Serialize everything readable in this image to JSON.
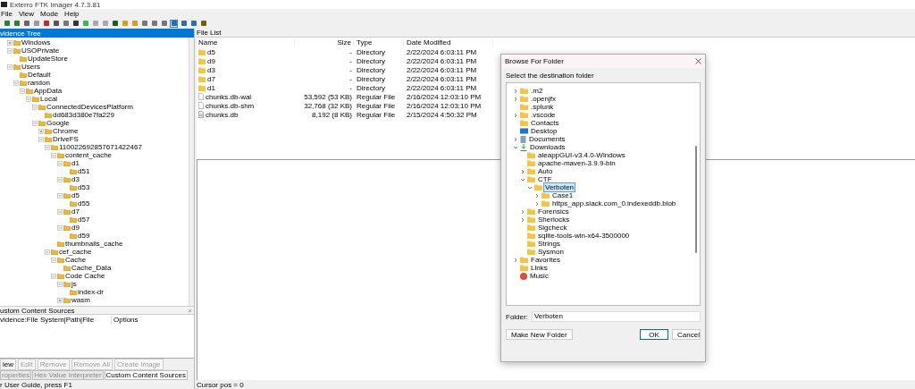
{
  "window": {
    "title": "Exterro FTK Imager 4.7.3.81"
  },
  "menu": [
    "File",
    "View",
    "Mode",
    "Help"
  ],
  "toolbar_buttons": [
    {
      "selected": false
    },
    {
      "selected": false
    },
    {
      "selected": false
    },
    {
      "selected": false
    },
    {
      "selected": false
    },
    {
      "selected": false
    },
    {
      "selected": false
    },
    {
      "selected": false
    },
    {
      "selected": false
    },
    {
      "selected": false
    },
    {
      "selected": false
    },
    {
      "selected": false
    },
    {
      "selected": false
    },
    {
      "selected": false
    },
    {
      "selected": false
    },
    {
      "selected": false
    },
    {
      "selected": false
    },
    {
      "selected": true
    },
    {
      "selected": false
    },
    {
      "selected": false
    },
    {
      "selected": false
    }
  ],
  "evidence_tree": {
    "title": "vidence Tree",
    "items": [
      {
        "label": "Windows",
        "expanded": false
      },
      {
        "label": "USOPrivate",
        "expanded": true,
        "children": [
          {
            "label": "UpdateStore"
          }
        ]
      },
      {
        "label": "Users",
        "expanded": true,
        "children": [
          {
            "label": "Default"
          },
          {
            "label": "randon",
            "expanded": true,
            "children": [
              {
                "label": "AppData",
                "expanded": true,
                "children": [
                  {
                    "label": "Local",
                    "expanded": true,
                    "children": [
                      {
                        "label": "ConnectedDevicesPlatform",
                        "expanded": true,
                        "children": [
                          {
                            "label": "dd683d380e7fa229"
                          }
                        ]
                      },
                      {
                        "label": "Google",
                        "expanded": true,
                        "children": [
                          {
                            "label": "Chrome",
                            "expanded": false
                          },
                          {
                            "label": "DriveFS",
                            "expanded": true,
                            "children": [
                              {
                                "label": "110022692857671422467",
                                "expanded": true,
                                "children": [
                                  {
                                    "label": "content_cache",
                                    "expanded": true,
                                    "children": [
                                      {
                                        "label": "d1",
                                        "expanded": true,
                                        "children": [
                                          {
                                            "label": "d51"
                                          }
                                        ]
                                      },
                                      {
                                        "label": "d3",
                                        "expanded": true,
                                        "children": [
                                          {
                                            "label": "d53"
                                          }
                                        ]
                                      },
                                      {
                                        "label": "d5",
                                        "expanded": true,
                                        "children": [
                                          {
                                            "label": "d55"
                                          }
                                        ]
                                      },
                                      {
                                        "label": "d7",
                                        "expanded": true,
                                        "children": [
                                          {
                                            "label": "d57"
                                          }
                                        ]
                                      },
                                      {
                                        "label": "d9",
                                        "expanded": true,
                                        "children": [
                                          {
                                            "label": "d59"
                                          }
                                        ]
                                      }
                                    ]
                                  },
                                  {
                                    "label": "thumbnails_cache"
                                  }
                                ]
                              },
                              {
                                "label": "cef_cache",
                                "expanded": true,
                                "children": [
                                  {
                                    "label": "Cache",
                                    "expanded": true,
                                    "children": [
                                      {
                                        "label": "Cache_Data"
                                      }
                                    ]
                                  },
                                  {
                                    "label": "Code Cache",
                                    "expanded": true,
                                    "children": [
                                      {
                                        "label": "js",
                                        "expanded": true,
                                        "children": [
                                          {
                                            "label": "index-dr"
                                          }
                                        ]
                                      },
                                      {
                                        "label": "wasm",
                                        "expanded": false
                                      }
                                    ]
                                  }
                                ]
                              }
                            ]
                          }
                        ]
                      }
                    ]
                  }
                ]
              }
            ]
          }
        ]
      }
    ]
  },
  "custom_content_sources": {
    "title": "ustom Content Sources",
    "close": "×",
    "columns": [
      "vidence:File System|Path|File",
      "Options"
    ],
    "buttons": [
      {
        "label": "iew",
        "disabled": false
      },
      {
        "label": "Edit",
        "disabled": true
      },
      {
        "label": "Remove",
        "disabled": true
      },
      {
        "label": "Remove All",
        "disabled": true
      },
      {
        "label": "Create Image",
        "disabled": true
      }
    ]
  },
  "bottom_tabs": [
    {
      "label": "roperties",
      "selected": false
    },
    {
      "label": "Hex Value Interpreter",
      "selected": false
    },
    {
      "label": "Custom Content Sources",
      "selected": true
    }
  ],
  "status_left": "r User Guide, press F1",
  "file_list": {
    "title": "File List",
    "columns": [
      "Name",
      "Size",
      "Type",
      "Date Modified"
    ],
    "rows": [
      {
        "kind": "folder",
        "name": "d5",
        "size": "-",
        "type": "Directory",
        "date": "2/22/2024 6:03:11 PM"
      },
      {
        "kind": "folder",
        "name": "d9",
        "size": "-",
        "type": "Directory",
        "date": "2/22/2024 6:03:11 PM"
      },
      {
        "kind": "folder",
        "name": "d3",
        "size": "-",
        "type": "Directory",
        "date": "2/22/2024 6:03:11 PM"
      },
      {
        "kind": "folder",
        "name": "d7",
        "size": "-",
        "type": "Directory",
        "date": "2/22/2024 6:03:11 PM"
      },
      {
        "kind": "folder",
        "name": "d1",
        "size": "-",
        "type": "Directory",
        "date": "2/22/2024 6:03:11 PM"
      },
      {
        "kind": "file",
        "name": "chunks.db-wal",
        "size": "53,592 (53 KB)",
        "type": "Regular File",
        "date": "2/16/2024 12:03:10 PM"
      },
      {
        "kind": "file",
        "name": "chunks.db-shm",
        "size": "32,768 (32 KB)",
        "type": "Regular File",
        "date": "2/16/2024 12:03:10 PM"
      },
      {
        "kind": "database",
        "name": "chunks.db",
        "size": "8,192 (8 KB)",
        "type": "Regular File",
        "date": "2/15/2024 4:50:32 PM"
      }
    ]
  },
  "status_right": "Cursor pos = 0",
  "dialog": {
    "title": "Browse For Folder",
    "prompt": "Select the destination folder",
    "items": [
      {
        "label": ".m2",
        "kind": "folder",
        "expanded": false
      },
      {
        "label": ".openjfx",
        "kind": "folder",
        "expanded": false
      },
      {
        "label": ".splunk",
        "kind": "folder"
      },
      {
        "label": ".vscode",
        "kind": "folder",
        "expanded": false
      },
      {
        "label": "Contacts",
        "kind": "folder"
      },
      {
        "label": "Desktop",
        "kind": "desktop"
      },
      {
        "label": "Documents",
        "kind": "documents",
        "expanded": false
      },
      {
        "label": "Downloads",
        "kind": "download",
        "expanded": true,
        "children": [
          {
            "label": "aleappGUI-v3.4.0-Windows",
            "kind": "folder"
          },
          {
            "label": "apache-maven-3.9.9-bin",
            "kind": "folder"
          },
          {
            "label": "Auto",
            "kind": "folder",
            "expanded": false
          },
          {
            "label": "CTF",
            "kind": "folder",
            "expanded": true,
            "children": [
              {
                "label": "Verboten",
                "kind": "folder",
                "expanded": true,
                "selected": true,
                "children": [
                  {
                    "label": "Case1",
                    "kind": "folder",
                    "expanded": false
                  },
                  {
                    "label": "https_app.slack.com_0.indexeddb.blob",
                    "kind": "folder",
                    "expanded": false
                  }
                ]
              }
            ]
          },
          {
            "label": "Forensics",
            "kind": "folder",
            "expanded": false
          },
          {
            "label": "Sherlocks",
            "kind": "folder",
            "expanded": false
          },
          {
            "label": "Sigcheck",
            "kind": "folder"
          },
          {
            "label": "sqlite-tools-win-x64-3500000",
            "kind": "folder"
          },
          {
            "label": "Strings",
            "kind": "folder"
          },
          {
            "label": "Sysmon",
            "kind": "folder"
          }
        ]
      },
      {
        "label": "Favorites",
        "kind": "folder",
        "expanded": false
      },
      {
        "label": "Links",
        "kind": "folder"
      },
      {
        "label": "Music",
        "kind": "music"
      }
    ],
    "folder_label": "Folder:",
    "folder_value": "Verboten",
    "buttons": [
      {
        "kind": "secondary",
        "label": "Make New Folder"
      },
      {
        "kind": "default",
        "label": "OK"
      },
      {
        "kind": "normal",
        "label": "Cancel"
      }
    ]
  }
}
